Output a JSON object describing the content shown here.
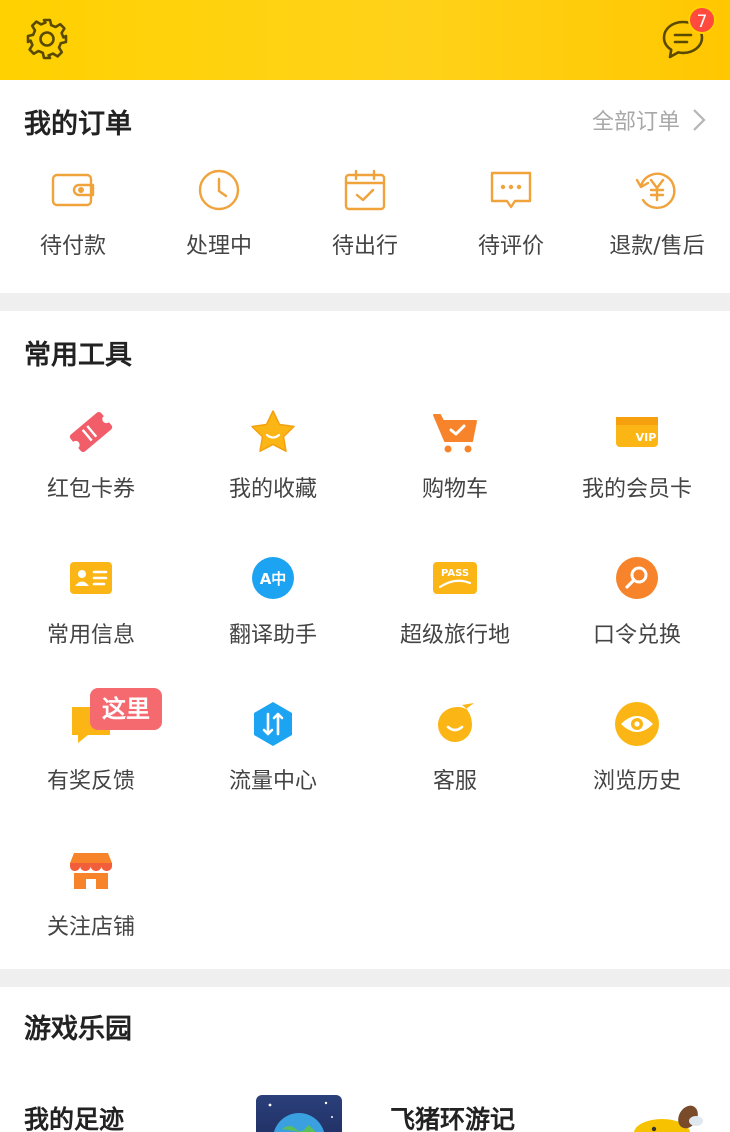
{
  "header": {
    "message_badge": "7"
  },
  "orders": {
    "title": "我的订单",
    "all_link": "全部订单",
    "items": [
      {
        "label": "待付款",
        "icon": "wallet-icon"
      },
      {
        "label": "处理中",
        "icon": "clock-icon"
      },
      {
        "label": "待出行",
        "icon": "calendar-check-icon"
      },
      {
        "label": "待评价",
        "icon": "comment-icon"
      },
      {
        "label": "退款/售后",
        "icon": "refund-yen-icon"
      }
    ]
  },
  "tools": {
    "title": "常用工具",
    "here_tag": "这里",
    "items": [
      {
        "label": "红包卡券",
        "icon": "coupon-ticket-icon"
      },
      {
        "label": "我的收藏",
        "icon": "star-icon"
      },
      {
        "label": "购物车",
        "icon": "cart-icon"
      },
      {
        "label": "我的会员卡",
        "icon": "vip-card-icon",
        "icon_text": "VIP"
      },
      {
        "label": "常用信息",
        "icon": "id-card-icon"
      },
      {
        "label": "翻译助手",
        "icon": "translate-icon",
        "icon_text": "A中"
      },
      {
        "label": "超级旅行地",
        "icon": "pass-icon",
        "icon_text": "PASS"
      },
      {
        "label": "口令兑换",
        "icon": "key-search-icon"
      },
      {
        "label": "有奖反馈",
        "icon": "feedback-icon"
      },
      {
        "label": "流量中心",
        "icon": "data-traffic-icon"
      },
      {
        "label": "客服",
        "icon": "customer-service-icon"
      },
      {
        "label": "浏览历史",
        "icon": "eye-icon"
      },
      {
        "label": "关注店铺",
        "icon": "shop-icon"
      }
    ]
  },
  "games": {
    "title": "游戏乐园",
    "footprint_label": "我的足迹",
    "travel_game_label": "飞猪环游记"
  },
  "colors": {
    "brand_yellow": "#ffd100",
    "icon_orange": "#f5a623",
    "badge_red": "#ff4a3d",
    "tag_red": "#f56a6f"
  }
}
